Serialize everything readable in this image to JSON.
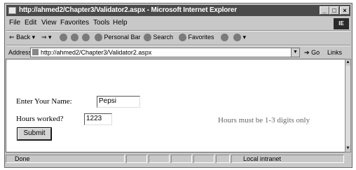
{
  "window": {
    "title": "http://ahmed2/Chapter3/Validator2.aspx - Microsoft Internet Explorer",
    "controls": {
      "minimize": "_",
      "maximize": "□",
      "close": "×"
    },
    "logo": "IE"
  },
  "menu": {
    "items": [
      "File",
      "Edit",
      "View",
      "Favorites",
      "Tools",
      "Help"
    ]
  },
  "toolbar": {
    "back_label": "Back",
    "back_arrow": "⇐",
    "forward_arrow": "⇒",
    "personal_bar_label": "Personal Bar",
    "search_label": "Search",
    "favorites_label": "Favorites"
  },
  "address": {
    "label": "Address",
    "url": "http://ahmed2/Chapter3/Validator2.aspx",
    "go_label": "Go",
    "links_label": "Links"
  },
  "form": {
    "name_label": "Enter Your Name:",
    "name_value": "Pepsi",
    "hours_label": "Hours worked?",
    "hours_value": "1223",
    "error_message": "Hours must be 1-3 digits only",
    "submit_label": "Submit"
  },
  "status": {
    "left_text": "Done",
    "zone_text": "Local intranet"
  }
}
